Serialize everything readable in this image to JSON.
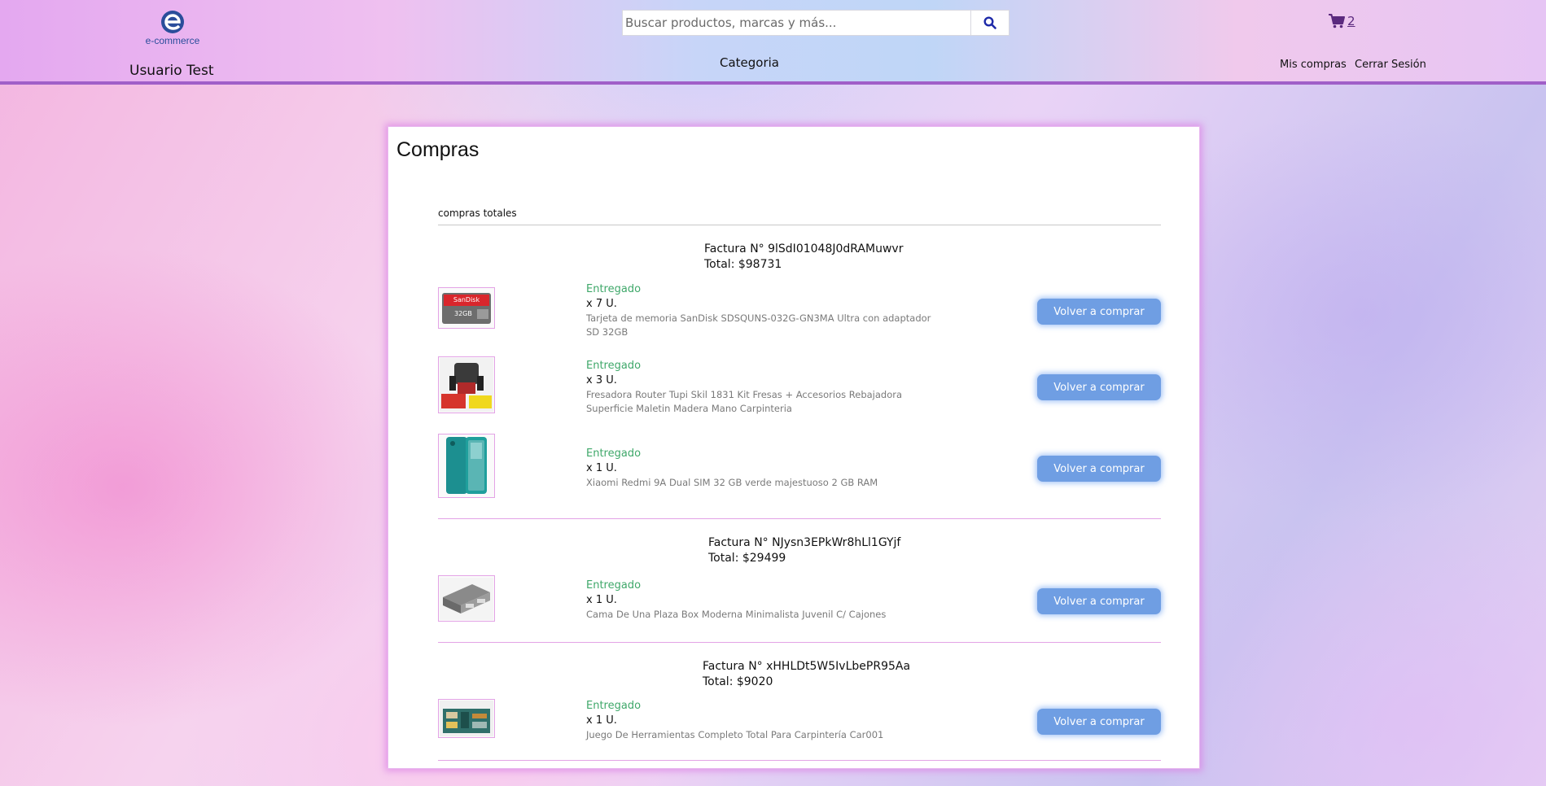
{
  "header": {
    "logo_text": "e-commerce",
    "username": "Usuario Test",
    "search_placeholder": "Buscar productos, marcas y más...",
    "category_label": "Categoria",
    "cart_count": "2",
    "nav": {
      "my_purchases": "Mis compras",
      "logout": "Cerrar Sesión"
    }
  },
  "panel": {
    "title": "Compras",
    "section_label": "compras totales",
    "orders": [
      {
        "invoice": "Factura N° 9lSdI01048J0dRAMuwvr",
        "total": "Total: $98731",
        "items": [
          {
            "status": "Entregado",
            "qty": "x 7 U.",
            "name": "Tarjeta de memoria SanDisk SDSQUNS-032G-GN3MA Ultra con adaptador SD 32GB",
            "image_icon": "sandisk-sd-card-image",
            "button": "Volver a comprar"
          },
          {
            "status": "Entregado",
            "qty": "x 3 U.",
            "name": "Fresadora Router Tupi Skil 1831 Kit Fresas + Accesorios Rebajadora Superficie Maletin Madera Mano Carpinteria",
            "image_icon": "router-tool-image",
            "button": "Volver a comprar"
          },
          {
            "status": "Entregado",
            "qty": "x 1 U.",
            "name": "Xiaomi Redmi 9A Dual SIM 32 GB verde majestuoso 2 GB RAM",
            "image_icon": "smartphone-image",
            "button": "Volver a comprar"
          }
        ]
      },
      {
        "invoice": "Factura N° NJysn3EPkWr8hLl1GYjf",
        "total": "Total: $29499",
        "items": [
          {
            "status": "Entregado",
            "qty": "x 1 U.",
            "name": "Cama De Una Plaza Box Moderna Minimalista Juvenil C/ Cajones",
            "image_icon": "bed-image",
            "button": "Volver a comprar"
          }
        ]
      },
      {
        "invoice": "Factura N° xHHLDt5W5IvLbePR95Aa",
        "total": "Total: $9020",
        "items": [
          {
            "status": "Entregado",
            "qty": "x 1 U.",
            "name": "Juego De Herramientas Completo Total Para Carpintería Car001",
            "image_icon": "tool-set-image",
            "button": "Volver a comprar"
          }
        ]
      }
    ]
  },
  "colors": {
    "header_border": "#a05fc8",
    "status_green": "#3fa86a",
    "button_blue": "#6f9ee3",
    "accent_pink": "#e3a3e6",
    "search_icon": "#1e2aa8"
  }
}
